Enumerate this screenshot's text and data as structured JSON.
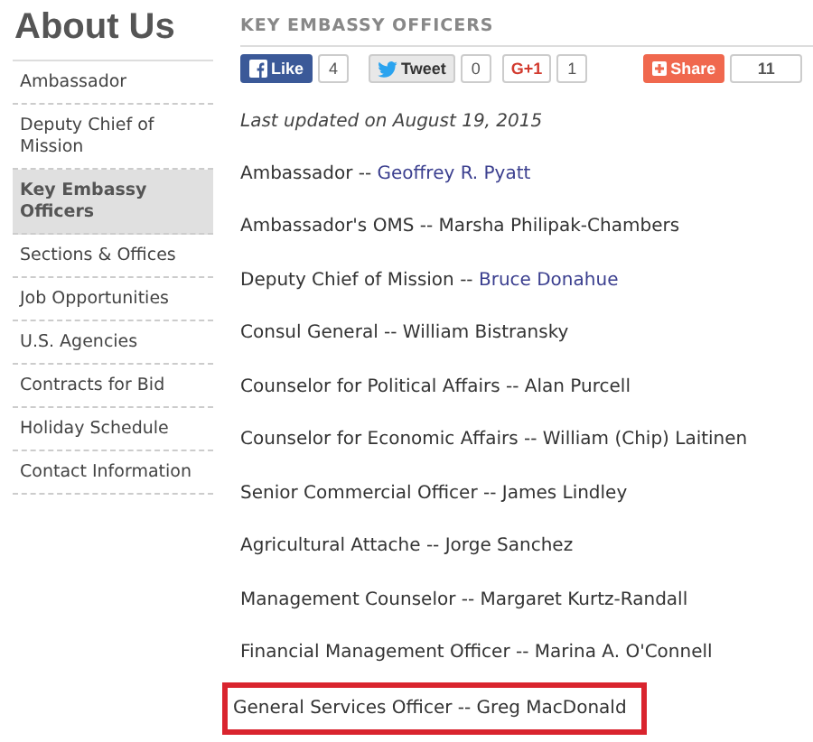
{
  "sidebar": {
    "title": "About Us",
    "items": [
      {
        "label": "Ambassador",
        "selected": false
      },
      {
        "label": "Deputy Chief of Mission",
        "selected": false
      },
      {
        "label": "Key Embassy Officers",
        "selected": true
      },
      {
        "label": "Sections & Offices",
        "selected": false
      },
      {
        "label": "Job Opportunities",
        "selected": false
      },
      {
        "label": "U.S. Agencies",
        "selected": false
      },
      {
        "label": "Contracts for Bid",
        "selected": false
      },
      {
        "label": "Holiday Schedule",
        "selected": false
      },
      {
        "label": "Contact Information",
        "selected": false
      }
    ]
  },
  "heading": "KEY EMBASSY OFFICERS",
  "social": [
    {
      "kind": "facebook",
      "label": "Like",
      "count": "4"
    },
    {
      "kind": "twitter",
      "label": "Tweet",
      "count": "0"
    },
    {
      "kind": "gplus",
      "label": "G+1",
      "count": "1"
    },
    {
      "kind": "share",
      "label": "Share",
      "count": "11"
    }
  ],
  "last_updated": "Last updated on August 19, 2015",
  "officers": [
    {
      "text": "Ambassador -- ",
      "link": "Geoffrey R. Pyatt",
      "highlighted": false
    },
    {
      "text": "Ambassador's OMS -- Marsha Philipak-Chambers",
      "highlighted": false
    },
    {
      "text": "Deputy Chief of Mission -- ",
      "link": "Bruce Donahue",
      "highlighted": false
    },
    {
      "text": "Consul General -- William Bistransky",
      "highlighted": false
    },
    {
      "text": "Counselor for Political Affairs -- Alan Purcell",
      "highlighted": false
    },
    {
      "text": "Counselor for Economic Affairs --  William (Chip) Laitinen",
      "highlighted": false
    },
    {
      "text": "Senior Commercial Officer -- James Lindley",
      "highlighted": false
    },
    {
      "text": "Agricultural Attache -- Jorge Sanchez",
      "highlighted": false
    },
    {
      "text": "Management Counselor -- Margaret Kurtz-Randall",
      "highlighted": false
    },
    {
      "text": "Financial Management Officer -- Marina A. O'Connell",
      "highlighted": false
    },
    {
      "text": "General Services Officer -- Greg MacDonald",
      "highlighted": true
    }
  ]
}
